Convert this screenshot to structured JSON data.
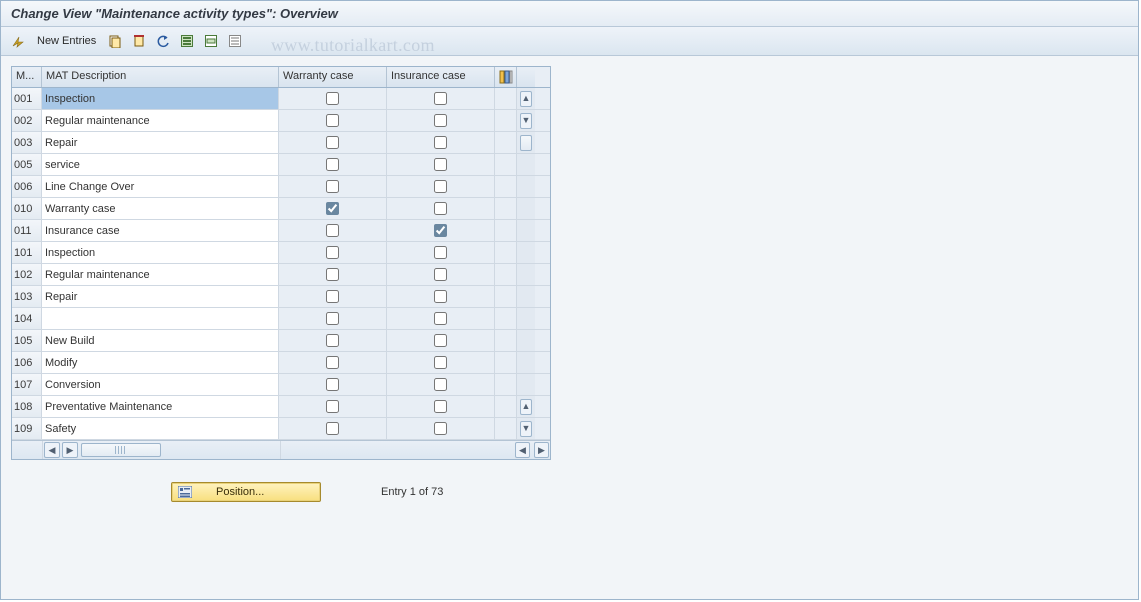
{
  "title": "Change View \"Maintenance activity types\": Overview",
  "watermark": "www.tutorialkart.com",
  "toolbar": {
    "new_entries_label": "New Entries",
    "icons": [
      "toggle-icon",
      "copy-icon",
      "delete-icon",
      "undo-icon",
      "select-all-icon",
      "select-block-icon",
      "deselect-icon"
    ]
  },
  "grid": {
    "columns": {
      "code": "M...",
      "desc": "MAT Description",
      "warr": "Warranty case",
      "ins": "Insurance case"
    },
    "rows": [
      {
        "code": "001",
        "desc": "Inspection",
        "warr": false,
        "ins": false,
        "selected": true
      },
      {
        "code": "002",
        "desc": "Regular maintenance",
        "warr": false,
        "ins": false
      },
      {
        "code": "003",
        "desc": "Repair",
        "warr": false,
        "ins": false
      },
      {
        "code": "005",
        "desc": "service",
        "warr": false,
        "ins": false
      },
      {
        "code": "006",
        "desc": "Line Change Over",
        "warr": false,
        "ins": false
      },
      {
        "code": "010",
        "desc": "Warranty case",
        "warr": true,
        "ins": false
      },
      {
        "code": "011",
        "desc": "Insurance case",
        "warr": false,
        "ins": true
      },
      {
        "code": "101",
        "desc": "Inspection",
        "warr": false,
        "ins": false
      },
      {
        "code": "102",
        "desc": "Regular maintenance",
        "warr": false,
        "ins": false
      },
      {
        "code": "103",
        "desc": "Repair",
        "warr": false,
        "ins": false
      },
      {
        "code": "104",
        "desc": "",
        "warr": false,
        "ins": false
      },
      {
        "code": "105",
        "desc": "New Build",
        "warr": false,
        "ins": false
      },
      {
        "code": "106",
        "desc": "Modify",
        "warr": false,
        "ins": false
      },
      {
        "code": "107",
        "desc": "Conversion",
        "warr": false,
        "ins": false
      },
      {
        "code": "108",
        "desc": "Preventative Maintenance",
        "warr": false,
        "ins": false
      },
      {
        "code": "109",
        "desc": "Safety",
        "warr": false,
        "ins": false
      }
    ]
  },
  "footer": {
    "position_label": "Position...",
    "entry_text": "Entry 1 of 73"
  },
  "colors": {
    "accent": "#9db5cc",
    "header_bg": "#e4ecf4",
    "cell_light": "#e8eef5",
    "button_yellow": "#f8df7e"
  }
}
